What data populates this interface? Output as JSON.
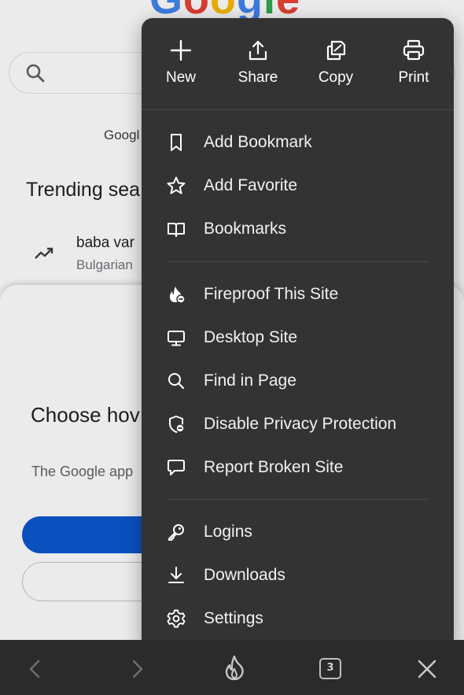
{
  "background": {
    "logo": {
      "c1": "G",
      "c2": "o",
      "c3": "o",
      "c4": "g",
      "c5": "l",
      "c6": "e"
    },
    "google_apps_text": "Googl",
    "trending_title": "Trending sea",
    "trend_query": "baba var",
    "trend_sub": "Bulgarian",
    "sheet_title": "Choose hov",
    "sheet_sub": "The Google app"
  },
  "menu": {
    "top_actions": [
      {
        "label": "New",
        "icon": "plus-icon"
      },
      {
        "label": "Share",
        "icon": "share-icon"
      },
      {
        "label": "Copy",
        "icon": "copy-icon"
      },
      {
        "label": "Print",
        "icon": "print-icon"
      }
    ],
    "items": [
      {
        "label": "Add Bookmark",
        "icon": "bookmark-icon"
      },
      {
        "label": "Add Favorite",
        "icon": "star-icon"
      },
      {
        "label": "Bookmarks",
        "icon": "book-icon"
      },
      {
        "label": "Fireproof This Site",
        "icon": "fireproof-icon"
      },
      {
        "label": "Desktop Site",
        "icon": "desktop-icon"
      },
      {
        "label": "Find in Page",
        "icon": "search-icon"
      },
      {
        "label": "Disable Privacy Protection",
        "icon": "shield-icon"
      },
      {
        "label": "Report Broken Site",
        "icon": "speech-bubble-icon"
      },
      {
        "label": "Logins",
        "icon": "key-icon"
      },
      {
        "label": "Downloads",
        "icon": "download-icon"
      },
      {
        "label": "Settings",
        "icon": "gear-icon"
      }
    ]
  },
  "toolbar": {
    "tab_count": "3"
  },
  "colors": {
    "menu_bg": "#333333",
    "toolbar_bg": "#2b2b2b",
    "primary_button": "#0b57d0"
  }
}
